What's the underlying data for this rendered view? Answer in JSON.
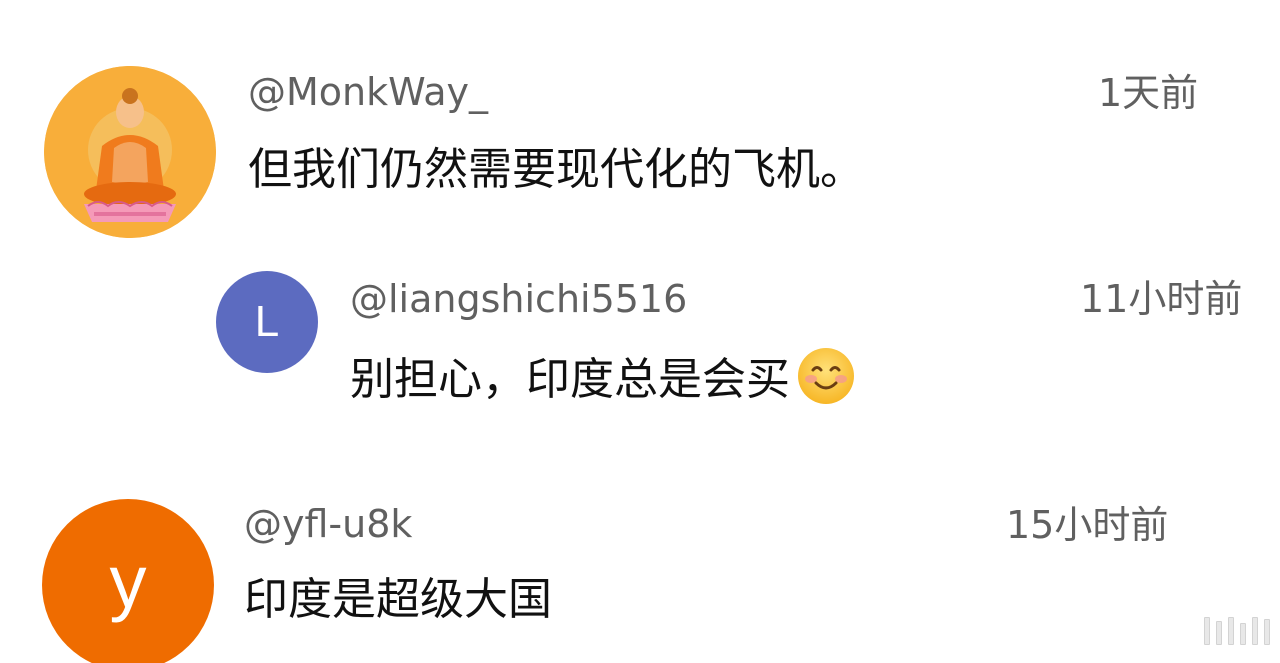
{
  "comments": [
    {
      "username": "@MonkWay_",
      "time": "1天前",
      "text": "但我们仍然需要现代化的飞机。",
      "avatar": {
        "kind": "image",
        "icon": "monk-avatar-icon",
        "color": "#F8AE3A"
      }
    },
    {
      "username": "@liangshichi5516",
      "time": "11小时前",
      "text": "别担心，印度总是会买",
      "emoji_icon": "smiling-face-emoji-icon",
      "avatar": {
        "kind": "letter",
        "letter": "L",
        "color": "#5C6BC0"
      }
    },
    {
      "username": "@yfl-u8k",
      "time": "15小时前",
      "text": "印度是超级大国",
      "avatar": {
        "kind": "letter",
        "letter": "y",
        "color": "#EF6C00"
      }
    }
  ]
}
